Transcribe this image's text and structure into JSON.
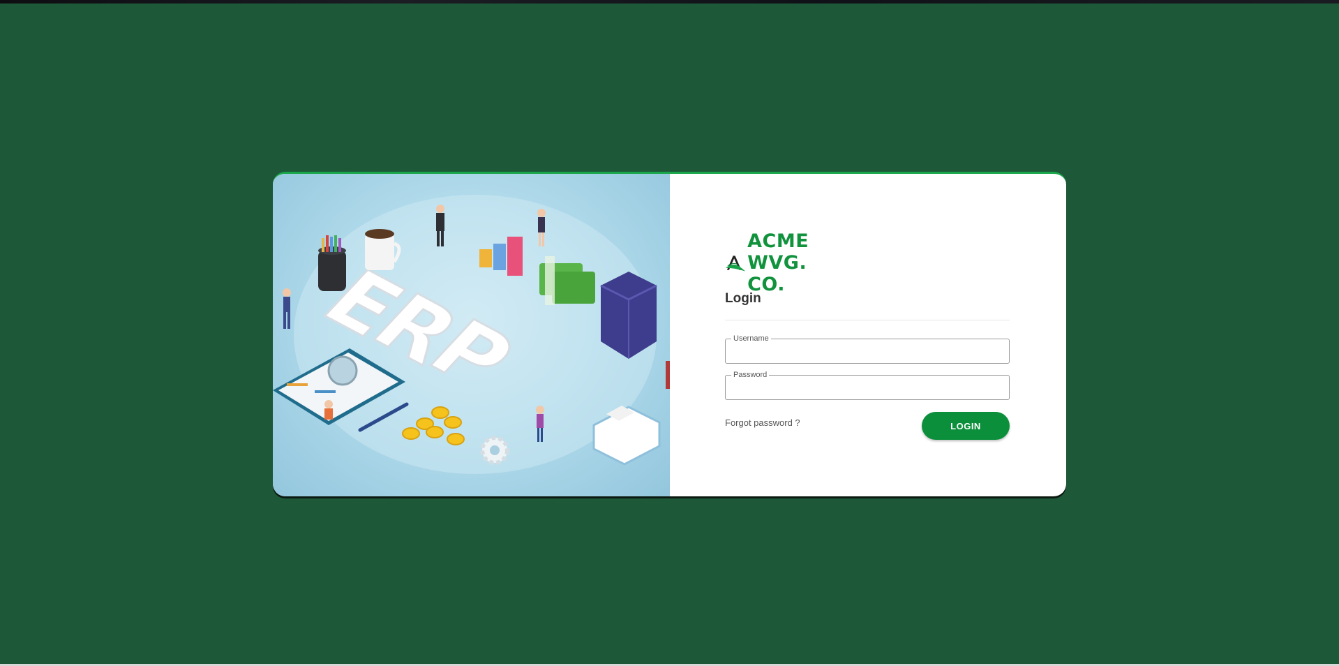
{
  "brand": {
    "name": "ACME WVG. CO.",
    "logo_icon": "acme-a-leaf-logo",
    "color": "#11923d"
  },
  "illustration": {
    "letters": [
      "E",
      "R",
      "P"
    ]
  },
  "login": {
    "title": "Login",
    "username_label": "Username",
    "username_value": "",
    "password_label": "Password",
    "password_value": "",
    "forgot_label": "Forgot password ?",
    "submit_label": "LOGIN"
  },
  "theme": {
    "background": "#1d5838",
    "accent": "#0b8f3b",
    "card_border": "#1aa64b"
  }
}
